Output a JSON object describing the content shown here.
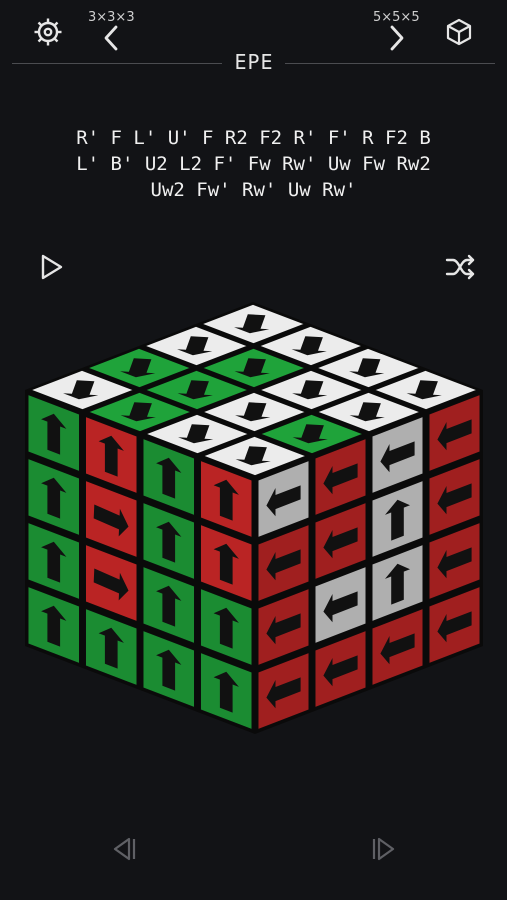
{
  "header": {
    "settings_icon": "gear-icon",
    "cube_icon": "cube-outline-icon",
    "prev_size_label": "3×3×3",
    "next_size_label": "5×5×5",
    "logo_text": "EPE"
  },
  "scramble": {
    "sequence": "R' F L' U' F R2 F2 R' F' R F2 B\nL' B' U2 L2 F' Fw Rw' Uw Fw Rw2\nUw2 Fw' Rw' Uw Rw'"
  },
  "controls": {
    "play_icon": "play-icon",
    "shuffle_icon": "shuffle-icon",
    "step_back_icon": "step-back-icon",
    "step_forward_icon": "step-forward-icon"
  },
  "colors": {
    "background": "#121316",
    "green": "#1fa33a",
    "red": "#d82a2a",
    "white": "#ececec",
    "arrow": "#111111"
  },
  "cube": {
    "size": "4x4x4",
    "top_face": [
      [
        "W",
        "W",
        "W",
        "W"
      ],
      [
        "W",
        "G",
        "W",
        "W"
      ],
      [
        "G",
        "G",
        "W",
        "G"
      ],
      [
        "W",
        "G",
        "W",
        "W"
      ]
    ],
    "left_face": [
      [
        "G",
        "R",
        "G",
        "R"
      ],
      [
        "G",
        "R",
        "G",
        "R"
      ],
      [
        "G",
        "R",
        "G",
        "G"
      ],
      [
        "G",
        "G",
        "G",
        "G"
      ]
    ],
    "right_face": [
      [
        "W",
        "R",
        "W",
        "R"
      ],
      [
        "R",
        "R",
        "W",
        "R"
      ],
      [
        "R",
        "W",
        "W",
        "R"
      ],
      [
        "R",
        "R",
        "R",
        "R"
      ]
    ]
  }
}
